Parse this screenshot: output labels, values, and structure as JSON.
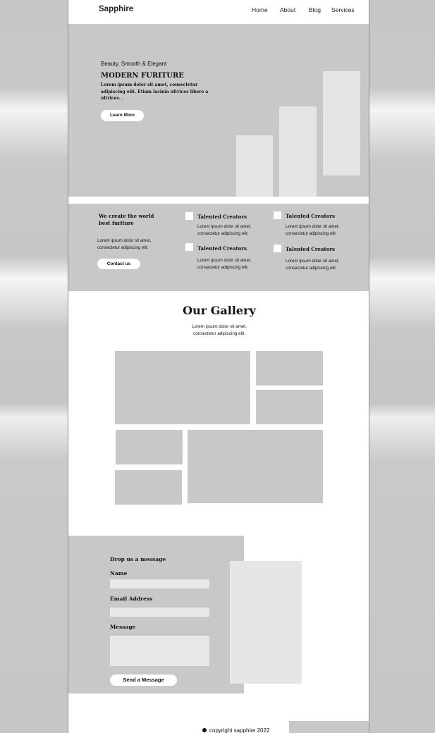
{
  "header": {
    "brand": "Sapphire",
    "nav": [
      "Home",
      "About",
      "Blog",
      "Services"
    ]
  },
  "hero": {
    "tagline": "Beauty, Smooth & Elegant",
    "title": "MODERN FURITURE",
    "body": "Lorem ipsum dolor sit amet, consectetur adipiscing elit. Etiam lacinia ultrices libero a ultrices. .",
    "cta": "Learn More"
  },
  "features": {
    "heading": "We create the world best furiture",
    "text": "Lorem ipsum dolor sit amet, consectetur adipiscing elit.",
    "cta": "Contact us",
    "items": [
      {
        "title": "Talented Creators",
        "text": "Lorem ipsum dolor sit amet, consectetur adipiscing elit."
      },
      {
        "title": "Talented Creators",
        "text": "Lorem ipsum dolor sit amet, consectetur adipiscing elit."
      },
      {
        "title": "Talented Creators",
        "text": "Lorem ipsum dolor sit amet, consectetur adipiscing elit."
      },
      {
        "title": "Talented Creators",
        "text": "Lorem ipsum dolor sit amet, consectetur adipiscing elit."
      }
    ]
  },
  "gallery": {
    "title": "Our Gallery",
    "subtitle": "Lorem ipsum dolor sit amet, consectetur adipiscing elit."
  },
  "contact": {
    "heading": "Drop us a  message",
    "name_label": "Name",
    "email_label": "Email  Address",
    "message_label": "Message",
    "submit": "Send a Message"
  },
  "footer": {
    "icon": "copyright-icon",
    "text": "copyright sapphire 2022"
  }
}
